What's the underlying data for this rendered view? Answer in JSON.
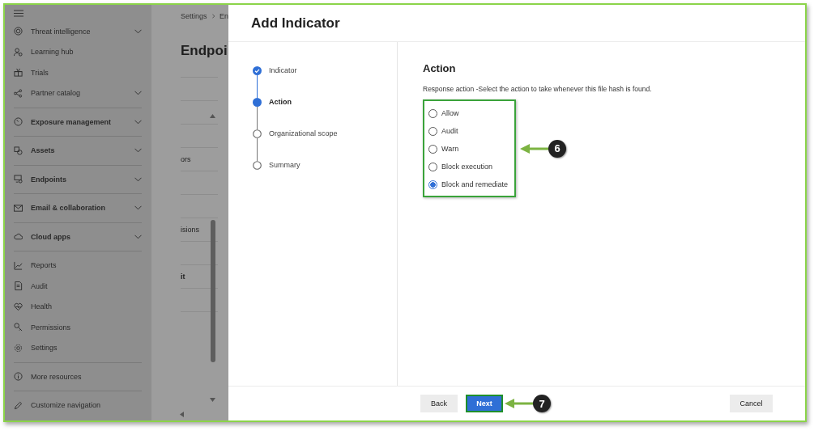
{
  "nav": {
    "sections": [
      [
        {
          "label": "Threat intelligence",
          "kind": "link",
          "has_submenu": true
        },
        {
          "label": "Learning hub",
          "kind": "link",
          "has_submenu": false
        },
        {
          "label": "Trials",
          "kind": "link",
          "has_submenu": false
        },
        {
          "label": "Partner catalog",
          "kind": "link",
          "has_submenu": true
        }
      ],
      [
        {
          "label": "Exposure management",
          "kind": "group",
          "has_submenu": true
        }
      ],
      [
        {
          "label": "Assets",
          "kind": "group",
          "has_submenu": true
        }
      ],
      [
        {
          "label": "Endpoints",
          "kind": "group",
          "has_submenu": true
        }
      ],
      [
        {
          "label": "Email & collaboration",
          "kind": "group",
          "has_submenu": true
        }
      ],
      [
        {
          "label": "Cloud apps",
          "kind": "group",
          "has_submenu": true
        }
      ],
      [
        {
          "label": "Reports",
          "kind": "link",
          "has_submenu": false
        },
        {
          "label": "Audit",
          "kind": "link",
          "has_submenu": false
        },
        {
          "label": "Health",
          "kind": "link",
          "has_submenu": false
        },
        {
          "label": "Permissions",
          "kind": "link",
          "has_submenu": false
        },
        {
          "label": "Settings",
          "kind": "link",
          "has_submenu": false
        }
      ],
      [
        {
          "label": "More resources",
          "kind": "link",
          "has_submenu": false
        }
      ],
      [
        {
          "label": "Customize navigation",
          "kind": "link",
          "has_submenu": false
        }
      ]
    ]
  },
  "background_page": {
    "breadcrumb": [
      "Settings",
      "En"
    ],
    "heading": "Endpoi",
    "rows": [
      {
        "text": "ors",
        "bold": false
      },
      {
        "text": "isions",
        "bold": false
      },
      {
        "text": "it",
        "bold": true
      }
    ]
  },
  "panel": {
    "title": "Add Indicator",
    "steps": [
      {
        "label": "Indicator",
        "completed": true,
        "selected": false
      },
      {
        "label": "Action",
        "completed": false,
        "selected": true
      },
      {
        "label": "Organizational scope",
        "completed": false,
        "selected": false
      },
      {
        "label": "Summary",
        "completed": false,
        "selected": false
      }
    ],
    "section_title": "Action",
    "description": "Response action -Select the action to take whenever this file hash is found.",
    "options_highlighted": true,
    "options": [
      {
        "label": "Allow",
        "selected": false
      },
      {
        "label": "Audit",
        "selected": false
      },
      {
        "label": "Warn",
        "selected": false
      },
      {
        "label": "Block execution",
        "selected": false
      },
      {
        "label": "Block and remediate",
        "selected": true
      }
    ],
    "buttons": [
      {
        "label": "Back",
        "kind": "secondary",
        "highlighted": false
      },
      {
        "label": "Next",
        "kind": "primary",
        "highlighted": true
      },
      {
        "label": "Cancel",
        "kind": "secondary",
        "highlighted": false
      }
    ]
  },
  "callouts": [
    {
      "number": "6"
    },
    {
      "number": "7"
    }
  ]
}
